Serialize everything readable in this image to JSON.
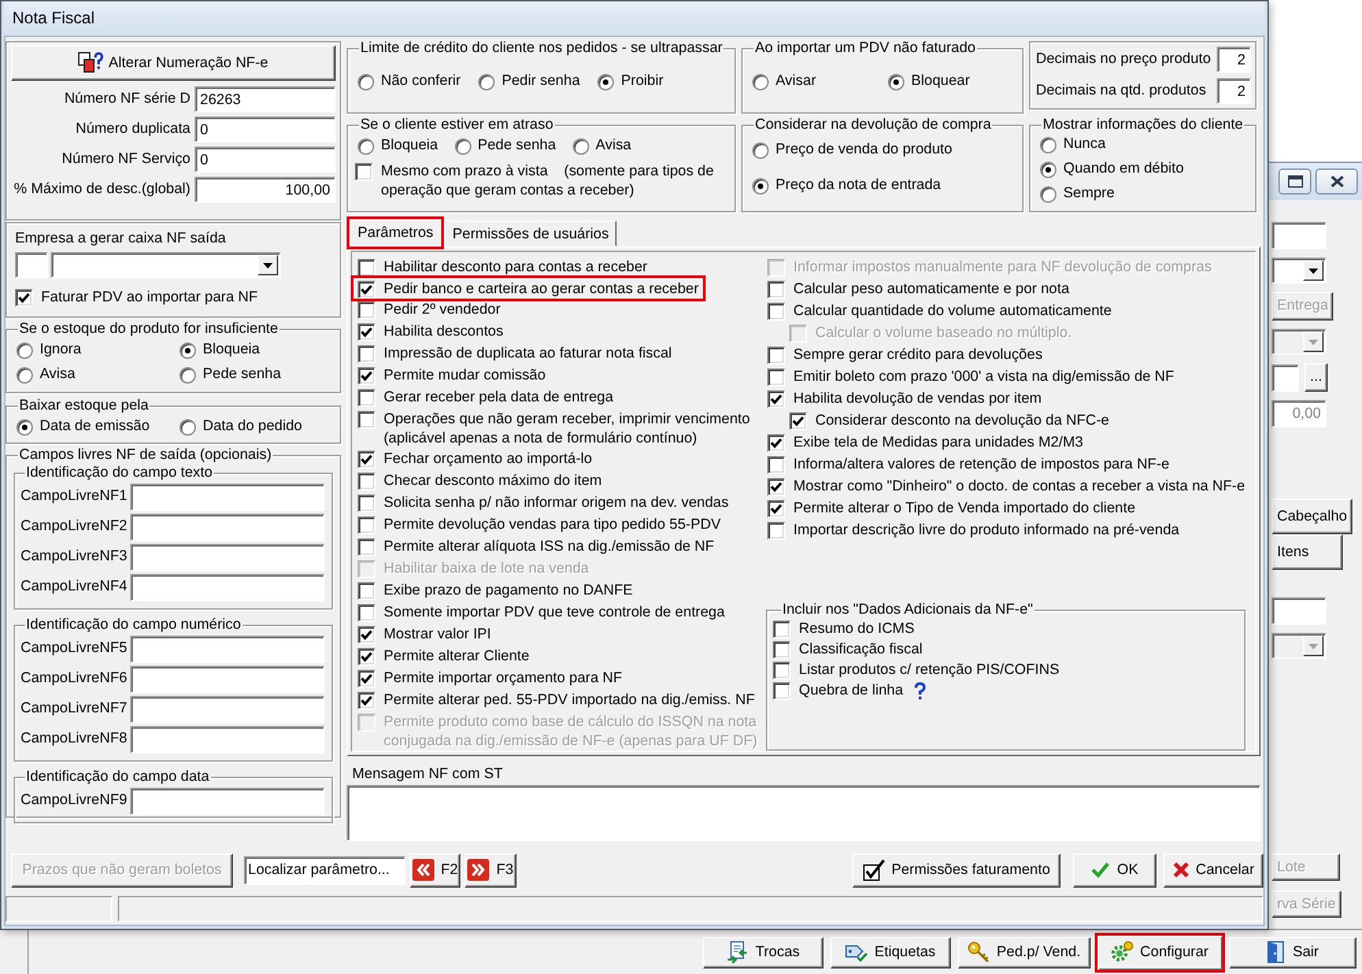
{
  "window": {
    "title": "Nota Fiscal"
  },
  "numbering": {
    "button": "Alterar Numeração NF-e",
    "fields": [
      {
        "label": "Número NF série D",
        "value": "26263",
        "kind": "text"
      },
      {
        "label": "Número duplicata",
        "value": "0",
        "kind": "text"
      },
      {
        "label": "Número NF Serviço",
        "value": "0",
        "kind": "text"
      },
      {
        "label": "% Máximo de desc.(global)",
        "value": "100,00",
        "kind": "number"
      }
    ]
  },
  "cash_company": {
    "label": "Empresa a gerar caixa NF saída",
    "checkbox": {
      "label": "Faturar PDV ao importar para NF",
      "checked": true
    }
  },
  "insufficient_stock": {
    "title": "Se o estoque do produto for insuficiente",
    "options": [
      {
        "label": "Ignora",
        "selected": false
      },
      {
        "label": "Bloqueia",
        "selected": true
      },
      {
        "label": "Avisa",
        "selected": false
      },
      {
        "label": "Pede senha",
        "selected": false
      }
    ]
  },
  "stock_deduction": {
    "title": "Baixar estoque pela",
    "options": [
      {
        "label": "Data de emissão",
        "selected": true
      },
      {
        "label": "Data do pedido",
        "selected": false
      }
    ]
  },
  "free_fields": {
    "title": "Campos livres NF de saída (opcionais)",
    "groups": [
      {
        "title": "Identificação do campo texto",
        "fields": [
          {
            "label": "CampoLivreNF1"
          },
          {
            "label": "CampoLivreNF2"
          },
          {
            "label": "CampoLivreNF3"
          },
          {
            "label": "CampoLivreNF4"
          }
        ]
      },
      {
        "title": "Identificação do campo numérico",
        "fields": [
          {
            "label": "CampoLivreNF5"
          },
          {
            "label": "CampoLivreNF6"
          },
          {
            "label": "CampoLivreNF7"
          },
          {
            "label": "CampoLivreNF8"
          }
        ]
      },
      {
        "title": "Identificação do campo data",
        "fields": [
          {
            "label": "CampoLivreNF9"
          }
        ]
      }
    ]
  },
  "credit_limit": {
    "title": "Limite de crédito do cliente nos pedidos - se ultrapassar",
    "options": [
      {
        "label": "Não conferir",
        "selected": false
      },
      {
        "label": "Pedir senha",
        "selected": false
      },
      {
        "label": "Proibir",
        "selected": true
      }
    ]
  },
  "unbilled_pdv": {
    "title": "Ao importar um PDV não faturado",
    "options": [
      {
        "label": "Avisar",
        "selected": false
      },
      {
        "label": "Bloquear",
        "selected": true
      }
    ]
  },
  "decimals": [
    {
      "label": "Decimais no preço produto",
      "value": "2"
    },
    {
      "label": "Decimais na qtd. produtos",
      "value": "2"
    }
  ],
  "overdue_client": {
    "title": "Se o cliente estiver em atraso",
    "options": [
      {
        "label": "Bloqueia",
        "selected": false
      },
      {
        "label": "Pede senha",
        "selected": false
      },
      {
        "label": "Avisa",
        "selected": false
      }
    ],
    "checkbox": {
      "label": "Mesmo com prazo à vista    (somente para tipos de operação que geram contas a receber)",
      "checked": false
    }
  },
  "purchase_return": {
    "title": "Considerar na devolução de compra",
    "options": [
      {
        "label": "Preço de venda do produto",
        "selected": false
      },
      {
        "label": "Preço da nota de entrada",
        "selected": true
      }
    ]
  },
  "client_info": {
    "title": "Mostrar informações do cliente",
    "options": [
      {
        "label": "Nunca",
        "selected": false
      },
      {
        "label": "Quando em débito",
        "selected": true
      },
      {
        "label": "Sempre",
        "selected": false
      }
    ]
  },
  "tabs": [
    {
      "label": "Parâmetros",
      "selected": true,
      "highlighted": true
    },
    {
      "label": "Permissões de usuários",
      "selected": false,
      "highlighted": false
    }
  ],
  "parameters": {
    "left": [
      {
        "label": "Habilitar desconto para contas a receber",
        "checked": false,
        "disabled": false,
        "highlighted": false
      },
      {
        "label": "Pedir banco e carteira ao gerar contas a receber",
        "checked": true,
        "disabled": false,
        "highlighted": true
      },
      {
        "label": "Pedir 2º vendedor",
        "checked": false,
        "disabled": false,
        "highlighted": false
      },
      {
        "label": "Habilita descontos",
        "checked": true,
        "disabled": false,
        "highlighted": false
      },
      {
        "label": "Impressão de duplicata ao faturar nota fiscal",
        "checked": false,
        "disabled": false,
        "highlighted": false
      },
      {
        "label": "Permite mudar comissão",
        "checked": true,
        "disabled": false,
        "highlighted": false
      },
      {
        "label": "Gerar receber pela data de entrega",
        "checked": false,
        "disabled": false,
        "highlighted": false
      },
      {
        "label": "Operações que não geram receber, imprimir vencimento (aplicável apenas a nota de formulário contínuo)",
        "checked": false,
        "disabled": false,
        "highlighted": false
      },
      {
        "label": "Fechar orçamento ao importá-lo",
        "checked": true,
        "disabled": false,
        "highlighted": false
      },
      {
        "label": "Checar desconto máximo do item",
        "checked": false,
        "disabled": false,
        "highlighted": false
      },
      {
        "label": "Solicita senha p/ não informar origem na dev. vendas",
        "checked": false,
        "disabled": false,
        "highlighted": false
      },
      {
        "label": "Permite devolução vendas para tipo pedido 55-PDV",
        "checked": false,
        "disabled": false,
        "highlighted": false
      },
      {
        "label": "Permite alterar alíquota ISS na dig./emissão de NF",
        "checked": false,
        "disabled": false,
        "highlighted": false
      },
      {
        "label": "Habilitar baixa de lote na venda",
        "checked": false,
        "disabled": true,
        "highlighted": false
      },
      {
        "label": "Exibe prazo de pagamento no DANFE",
        "checked": false,
        "disabled": false,
        "highlighted": false
      },
      {
        "label": "Somente importar PDV que teve controle de entrega",
        "checked": false,
        "disabled": false,
        "highlighted": false
      },
      {
        "label": "Mostrar valor IPI",
        "checked": true,
        "disabled": false,
        "highlighted": false
      },
      {
        "label": "Permite alterar Cliente",
        "checked": true,
        "disabled": false,
        "highlighted": false
      },
      {
        "label": "Permite importar orçamento para NF",
        "checked": true,
        "disabled": false,
        "highlighted": false
      },
      {
        "label": "Permite alterar ped. 55-PDV importado na dig./emiss. NF",
        "checked": true,
        "disabled": false,
        "highlighted": false
      },
      {
        "label": "Permite produto como base de cálculo do ISSQN na nota conjugada na dig./emissão de NF-e (apenas para UF DF)",
        "checked": false,
        "disabled": true,
        "highlighted": false
      }
    ],
    "right": [
      {
        "label": "Informar impostos manualmente para NF devolução de compras",
        "checked": false,
        "disabled": true,
        "highlighted": false
      },
      {
        "label": "Calcular peso automaticamente e por nota",
        "checked": false,
        "disabled": false,
        "highlighted": false
      },
      {
        "label": "Calcular quantidade do volume automaticamente",
        "checked": false,
        "disabled": false,
        "highlighted": false,
        "children": [
          {
            "label": "Calcular o volume baseado no múltiplo.",
            "checked": false,
            "disabled": true,
            "highlighted": false
          }
        ]
      },
      {
        "label": "Sempre gerar crédito para devoluções",
        "checked": false,
        "disabled": false,
        "highlighted": false
      },
      {
        "label": "Emitir boleto com prazo '000' a vista na dig/emissão de NF",
        "checked": false,
        "disabled": false,
        "highlighted": false
      },
      {
        "label": "Habilita devolução de vendas por item",
        "checked": true,
        "disabled": false,
        "highlighted": false,
        "children": [
          {
            "label": "Considerar desconto na devolução da NFC-e",
            "checked": true,
            "disabled": false,
            "highlighted": false
          }
        ]
      },
      {
        "label": "Exibe tela de Medidas para unidades M2/M3",
        "checked": true,
        "disabled": false,
        "highlighted": false
      },
      {
        "label": "Informa/altera valores de retenção de impostos para NF-e",
        "checked": false,
        "disabled": false,
        "highlighted": false
      },
      {
        "label": "Mostrar como \"Dinheiro\" o docto. de contas a receber a vista na NF-e",
        "checked": true,
        "disabled": false,
        "highlighted": false
      },
      {
        "label": "Permite alterar o Tipo de Venda importado do cliente",
        "checked": true,
        "disabled": false,
        "highlighted": false
      },
      {
        "label": "Importar descrição livre do produto informado na pré-venda",
        "checked": false,
        "disabled": false,
        "highlighted": false
      }
    ],
    "additional_data": {
      "title": "Incluir nos \"Dados Adicionais da NF-e\"",
      "options": [
        {
          "label": "Resumo do ICMS",
          "checked": false,
          "help": false
        },
        {
          "label": "Classificação fiscal",
          "checked": false,
          "help": false
        },
        {
          "label": "Listar produtos c/ retenção PIS/COFINS",
          "checked": false,
          "help": false
        },
        {
          "label": "Quebra de linha",
          "checked": false,
          "help": true
        }
      ]
    }
  },
  "message": {
    "label": "Mensagem NF com ST"
  },
  "footer": {
    "left": [
      {
        "kind": "plain",
        "label": "Prazos que não geram boletos",
        "disabled": true
      },
      {
        "kind": "search",
        "value": "Localizar parâmetro...",
        "disabled": false
      },
      {
        "kind": "previous",
        "label": "F2",
        "disabled": false
      },
      {
        "kind": "next",
        "label": "F3",
        "disabled": false
      }
    ],
    "right": [
      {
        "kind": "permissions",
        "label": "Permissões faturamento",
        "disabled": false
      },
      {
        "kind": "ok",
        "label": "OK",
        "disabled": false
      },
      {
        "kind": "cancel",
        "label": "Cancelar",
        "disabled": false
      }
    ]
  },
  "background_window": {
    "side": [
      {
        "items": [
          {
            "kind": "field"
          },
          {
            "kind": "combo",
            "disabled": false
          },
          {
            "kind": "button",
            "label": "Entrega",
            "disabled": true
          },
          {
            "kind": "combo",
            "disabled": true
          },
          {
            "kind": "browse",
            "label": "...",
            "disabled": false
          },
          {
            "kind": "field",
            "value": "0,00",
            "disabled": true
          }
        ]
      },
      {
        "items": [
          {
            "kind": "button",
            "label": "Cabeçalho",
            "disabled": false
          },
          {
            "kind": "button",
            "label": "Itens",
            "disabled": false
          }
        ]
      },
      {
        "items": [
          {
            "kind": "field"
          },
          {
            "kind": "combo",
            "disabled": true
          }
        ]
      },
      {
        "items": [
          {
            "kind": "button",
            "label": "Lote",
            "disabled": true
          },
          {
            "kind": "button",
            "label": "rva Série",
            "disabled": true
          }
        ]
      }
    ],
    "toolbar": [
      {
        "kind": "swap",
        "label": "Trocas",
        "highlighted": false
      },
      {
        "kind": "labels",
        "label": "Etiquetas",
        "highlighted": false
      },
      {
        "kind": "orders",
        "label": "Ped.p/ Vend.",
        "highlighted": false
      },
      {
        "kind": "settings",
        "label": "Configurar",
        "highlighted": true
      },
      {
        "kind": "exit",
        "label": "Sair",
        "highlighted": false
      }
    ]
  }
}
